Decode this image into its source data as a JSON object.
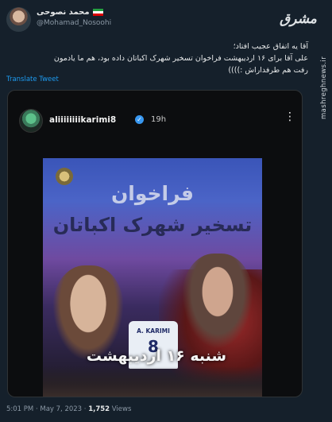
{
  "author": {
    "display_name": "محمد نصوحی",
    "handle": "@Mohamad_Nosoohi",
    "flag_colors": [
      "#239f40",
      "#ffffff",
      "#da0000"
    ]
  },
  "brand": {
    "logo_text": "مشرق",
    "watermark": "mashreghnews.ir"
  },
  "tweet": {
    "lines": [
      "آقا یه اتفاق عجیب افتاد؛",
      "علی آقا برای ۱۶ اردیبهشت فراخوان تسخیر شهرک اکباتان داده بود، هم ما یادمون",
      "رفت هم طرفداراش :))))"
    ],
    "translate_label": "Translate Tweet"
  },
  "story": {
    "username": "aliiiiiiiikarimi8",
    "verified_symbol": "✓",
    "time": "19h",
    "menu_symbol": "⋮"
  },
  "poster": {
    "title_line1": "فراخوان",
    "title_line2": "تسخیر شهرک اکباتان",
    "jersey_name": "A. KARIMI",
    "jersey_number": "8",
    "date_text": "شنبه ۱۶ اردیبهشت"
  },
  "meta": {
    "time": "5:01 PM",
    "date": "May 7, 2023",
    "views_count": "1,752",
    "views_label": "Views"
  }
}
